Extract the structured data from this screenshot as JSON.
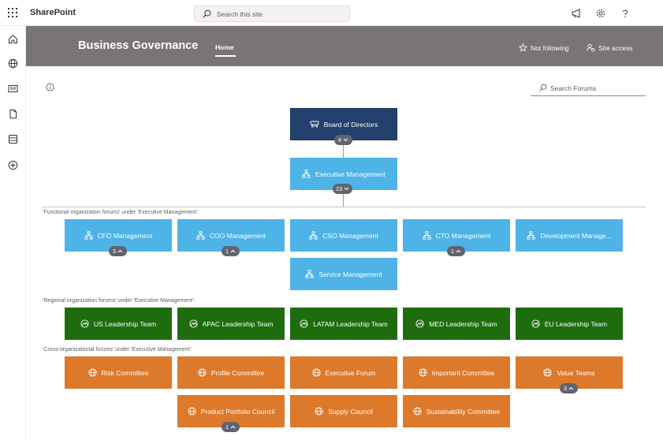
{
  "suite": {
    "app_name": "SharePoint",
    "search_placeholder": "Search this site"
  },
  "site": {
    "title": "Business Governance",
    "nav_home": "Home",
    "follow_label": "Not following",
    "access_label": "Site access"
  },
  "forum_search": {
    "placeholder": "Search Forums"
  },
  "org": {
    "board": {
      "label": "Board of Directors",
      "count": "4"
    },
    "executive": {
      "label": "Executive Management",
      "count": "23"
    },
    "functional": {
      "heading": "'Functional organization forums' under 'Executive Management':",
      "items": [
        {
          "label": "CFO Management",
          "count": "3"
        },
        {
          "label": "COO Management",
          "count": "1"
        },
        {
          "label": "CSO Management"
        },
        {
          "label": "CTO Management",
          "count": "1"
        },
        {
          "label": "Development Manage..."
        },
        {
          "label": "Service Management"
        }
      ]
    },
    "regional": {
      "heading": "'Regional organization forums' under 'Executive Management':",
      "items": [
        {
          "label": "US Leadership Team"
        },
        {
          "label": "APAC Leadership Team"
        },
        {
          "label": "LATAM Leadership Team"
        },
        {
          "label": "MED Leadership Team"
        },
        {
          "label": "EU Leadership Team"
        }
      ]
    },
    "cross": {
      "heading": "'Cross-organizational forums' under 'Executive Management':",
      "items": [
        {
          "label": "Risk Committee"
        },
        {
          "label": "Profile Committee"
        },
        {
          "label": "Executive Forum"
        },
        {
          "label": "Important Committee"
        },
        {
          "label": "Value Teams",
          "count": "3"
        },
        {
          "label": "Product Portfolio Council",
          "count": "1"
        },
        {
          "label": "Supply Council"
        },
        {
          "label": "Sustainability Committee"
        }
      ]
    }
  },
  "icons": {
    "suite": [
      "app-launcher-icon",
      "megaphone-icon",
      "gear-icon",
      "help-icon"
    ],
    "rail": [
      "home-icon",
      "globe-icon",
      "news-icon",
      "document-icon",
      "list-icon",
      "add-icon"
    ],
    "functional_node": "org-chart-icon",
    "regional_node": "region-icon",
    "cross_node": "globe-icon",
    "board_node": "boardroom-icon"
  },
  "colors": {
    "navy": "#23406f",
    "blue": "#4eb3e6",
    "green": "#1f6c0f",
    "orange": "#dd792b",
    "header": "#7a7574",
    "badge": "#626370"
  }
}
